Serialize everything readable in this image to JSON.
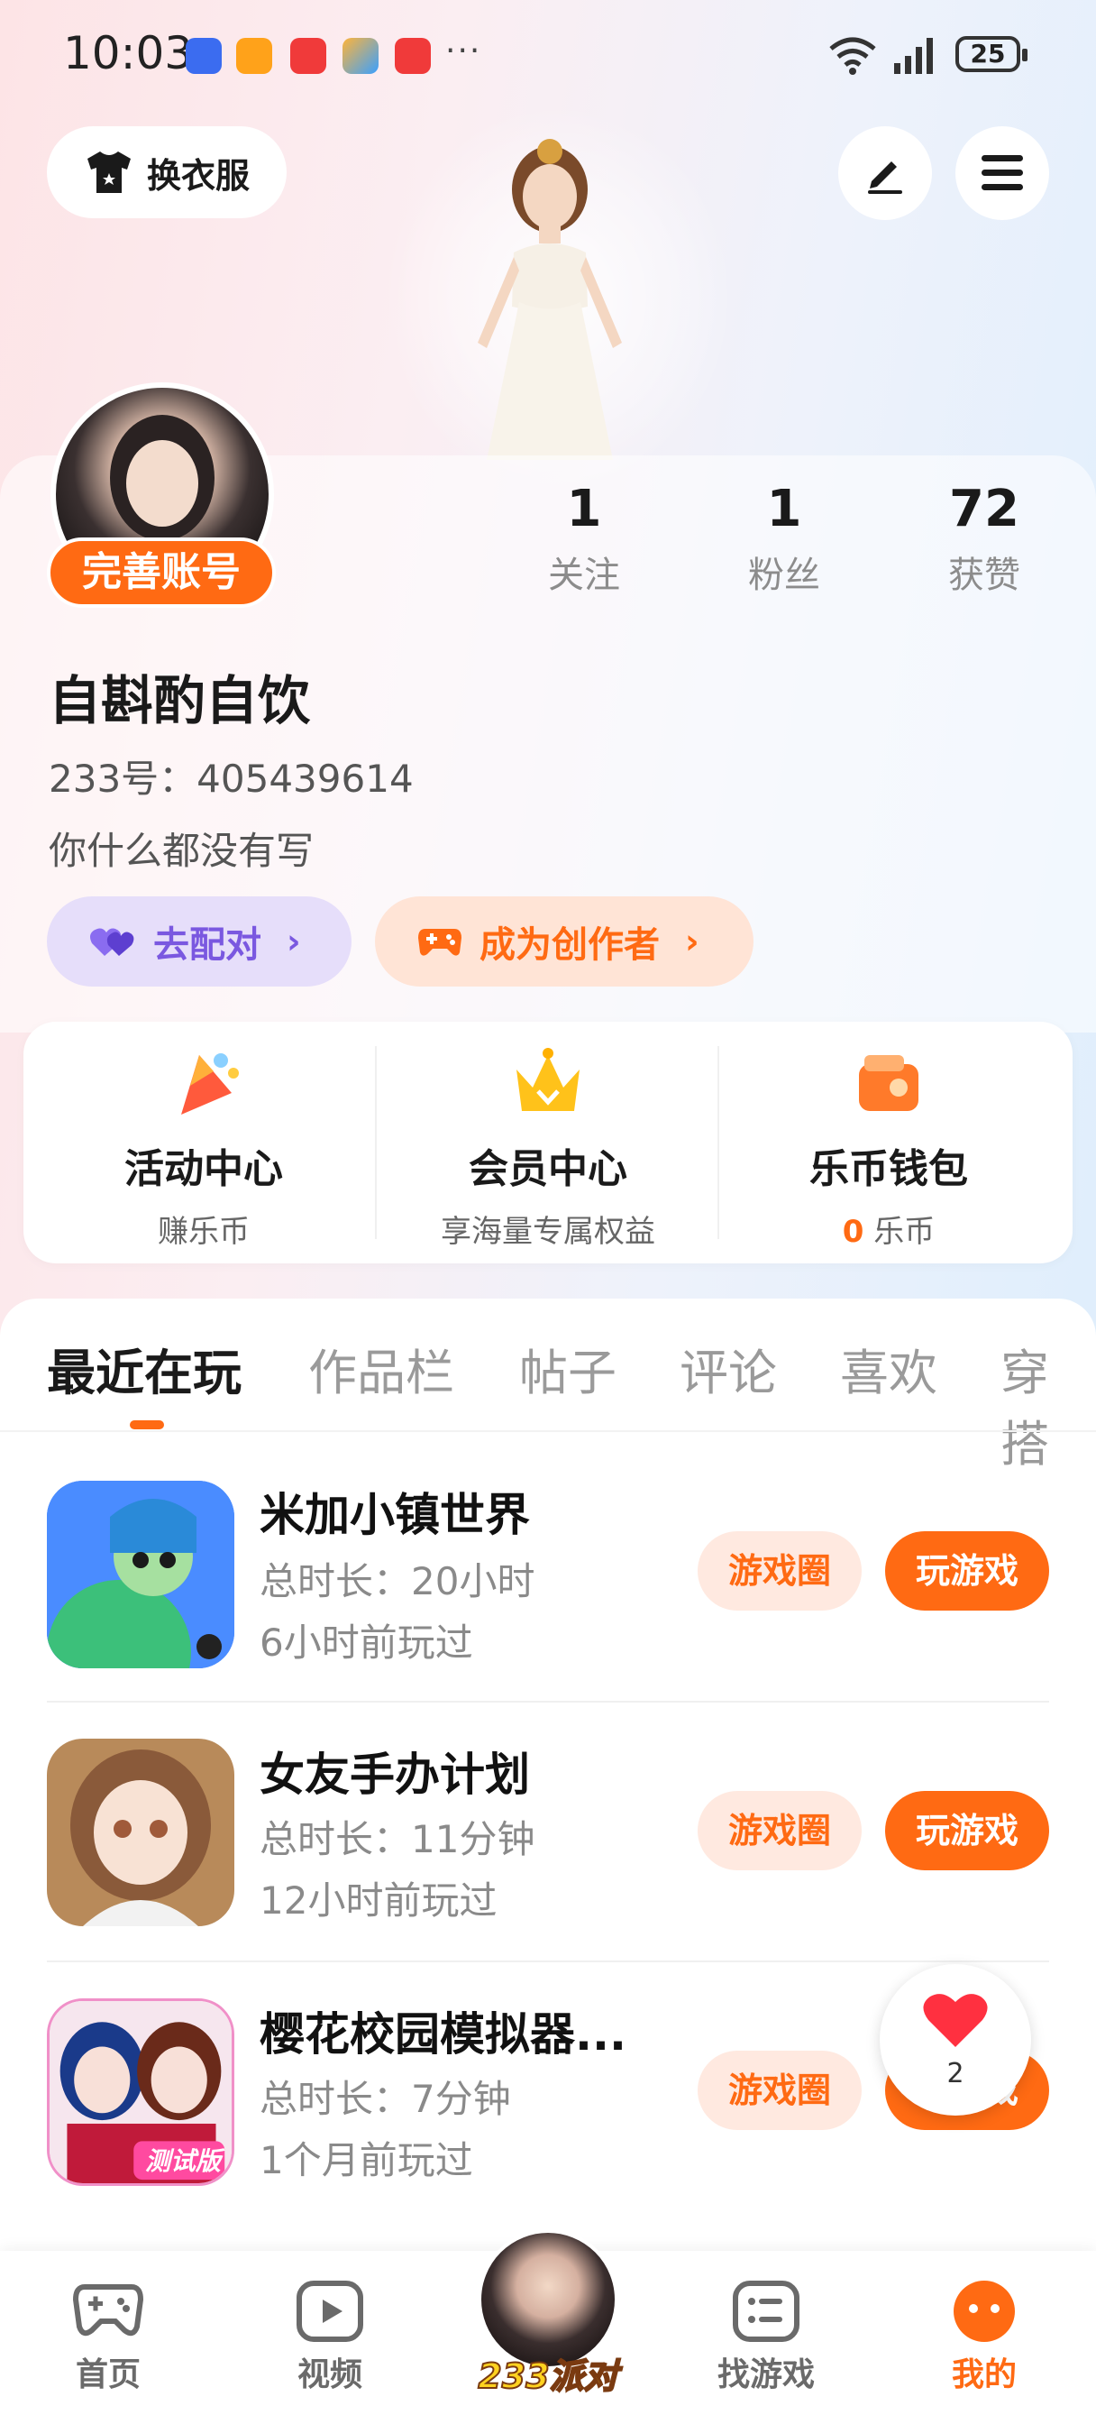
{
  "status_bar": {
    "time": "10:03",
    "more": "···",
    "battery": "25"
  },
  "top_bar": {
    "dress_label": "换衣服"
  },
  "profile": {
    "complete_tag": "完善账号",
    "name": "自斟酌自饮",
    "uid": "233号：405439614",
    "bio": "你什么都没有写",
    "stats": [
      {
        "value": "1",
        "label": "关注"
      },
      {
        "value": "1",
        "label": "粉丝"
      },
      {
        "value": "72",
        "label": "获赞"
      }
    ],
    "match_label": "去配对",
    "creator_label": "成为创作者"
  },
  "services": [
    {
      "title": "活动中心",
      "sub": "赚乐币"
    },
    {
      "title": "会员中心",
      "sub": "享海量专属权益"
    },
    {
      "title": "乐币钱包",
      "sub_value": "0",
      "sub_unit": " 乐币"
    }
  ],
  "tabs": [
    "最近在玩",
    "作品栏",
    "帖子",
    "评论",
    "喜欢",
    "穿搭"
  ],
  "games": [
    {
      "title": "米加小镇世界",
      "duration": "总时长：20小时",
      "last": "6小时前玩过",
      "circle_label": "游戏圈",
      "play_label": "玩游戏"
    },
    {
      "title": "女友手办计划",
      "duration": "总时长：11分钟",
      "last": "12小时前玩过",
      "circle_label": "游戏圈",
      "play_label": "玩游戏"
    },
    {
      "title": "樱花校园模拟器...",
      "duration": "总时长：7分钟",
      "last": "1个月前玩过",
      "circle_label": "游戏圈",
      "play_label": "玩游戏",
      "icon_badge": "测试版"
    }
  ],
  "fab": {
    "count": "2"
  },
  "bottom_nav": [
    {
      "label": "首页"
    },
    {
      "label": "视频"
    },
    {
      "label": "233派对"
    },
    {
      "label": "找游戏"
    },
    {
      "label": "我的"
    }
  ],
  "colors": {
    "accent": "#ff6a13",
    "purple": "#7a58e0",
    "bg_pink": "#fde4e6",
    "bg_blue": "#dfeefc"
  }
}
